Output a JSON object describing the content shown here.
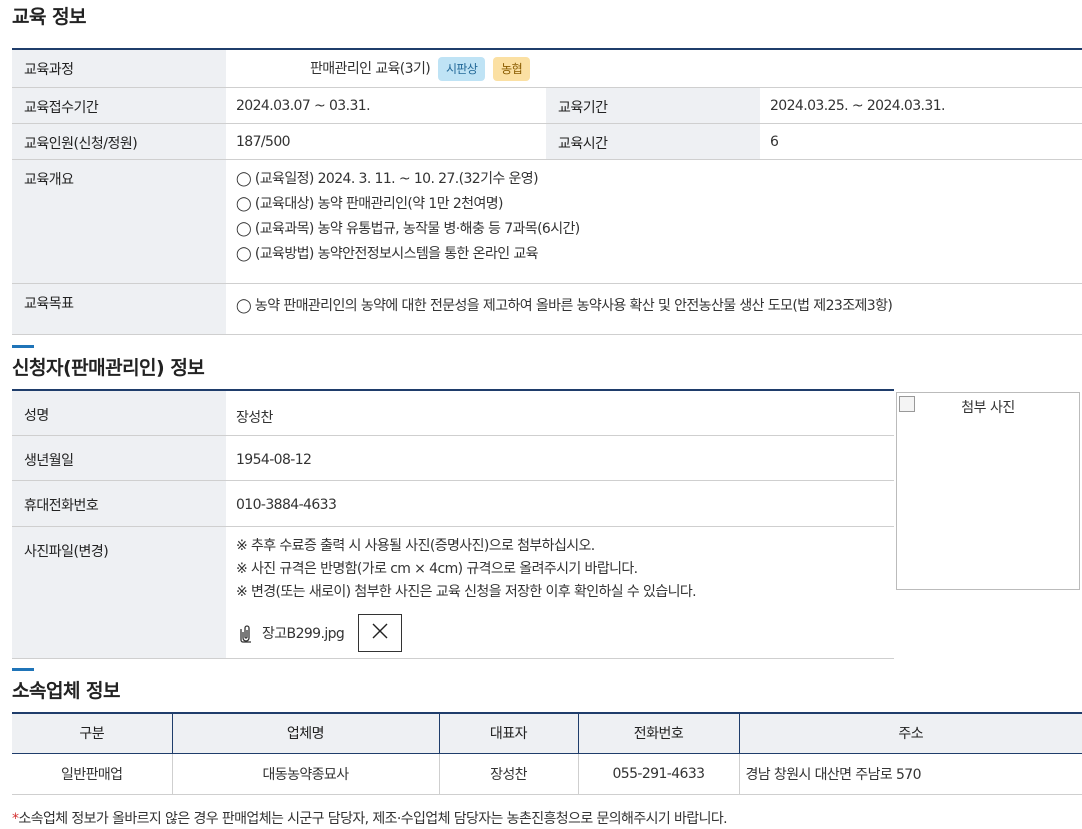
{
  "edu": {
    "title": "교육 정보",
    "course_label": "교육과정",
    "course_value": "판매관리인 교육(3기)",
    "badge1": "시판상",
    "badge2": "농협",
    "reg_period_label": "교육접수기간",
    "reg_period_value": "2024.03.07 ~ 03.31.",
    "period_label": "교육기간",
    "period_value": "2024.03.25. ~ 2024.03.31.",
    "people_label": "교육인원(신청/정원)",
    "people_value": "187/500",
    "hours_label": "교육시간",
    "hours_value": "6",
    "overview_label": "교육개요",
    "overview": [
      "◯ (교육일정) 2024. 3. 11. ~ 10. 27.(32기수 운영)",
      "◯ (교육대상) 농약 판매관리인(약 1만 2천여명)",
      "◯ (교육과목) 농약 유통법규, 농작물 병·해충 등 7과목(6시간)",
      "◯ (교육방법) 농약안전정보시스템을 통한 온라인 교육"
    ],
    "goal_label": "교육목표",
    "goal_value": "◯  농약 판매관리인의 농약에 대한 전문성을 제고하여 올바른 농약사용 확산 및 안전농산물 생산 도모(법 제23조제3항)"
  },
  "applicant": {
    "title": "신청자(판매관리인) 정보",
    "name_label": "성명",
    "name_value": "장성찬",
    "birth_label": "생년월일",
    "birth_value": "1954-08-12",
    "phone_label": "휴대전화번호",
    "phone_value": "010-3884-4633",
    "photo_label": "사진파일(변경)",
    "notes": [
      "※ 추후 수료증 출력 시 사용될 사진(증명사진)으로 첨부하십시오.",
      "※ 사진 규격은 반명함(가로 cm × 4cm) 규격으로 올려주시기 바랍니다.",
      "※ 변경(또는 새로이) 첨부한 사진은 교육 신청을 저장한 이후 확인하실 수 있습니다."
    ],
    "file_name": "장고B299.jpg",
    "photo_alt": "첨부 사진"
  },
  "company": {
    "title": "소속업체 정보",
    "headers": [
      "구분",
      "업체명",
      "대표자",
      "전화번호",
      "주소"
    ],
    "row": [
      "일반판매업",
      "대동농약종묘사",
      "장성찬",
      "055-291-4633",
      "경남 창원시 대산면 주남로 570"
    ],
    "footnote_star": "*",
    "footnote": "소속업체 정보가 올바르지 않은 경우 판매업체는 시군구 담당자, 제조·수입업체 담당자는 농촌진흥청으로 문의해주시기 바랍니다."
  },
  "icons": {
    "attach": "paperclip-icon",
    "delete": "close-icon",
    "broken_image": "broken-image-icon"
  },
  "colors": {
    "accent": "#1f74b8",
    "table_border": "#1f3d6b",
    "badge_blue": "#bfe3f5",
    "badge_yellow": "#fbe0a3",
    "required": "#d32f2f"
  }
}
